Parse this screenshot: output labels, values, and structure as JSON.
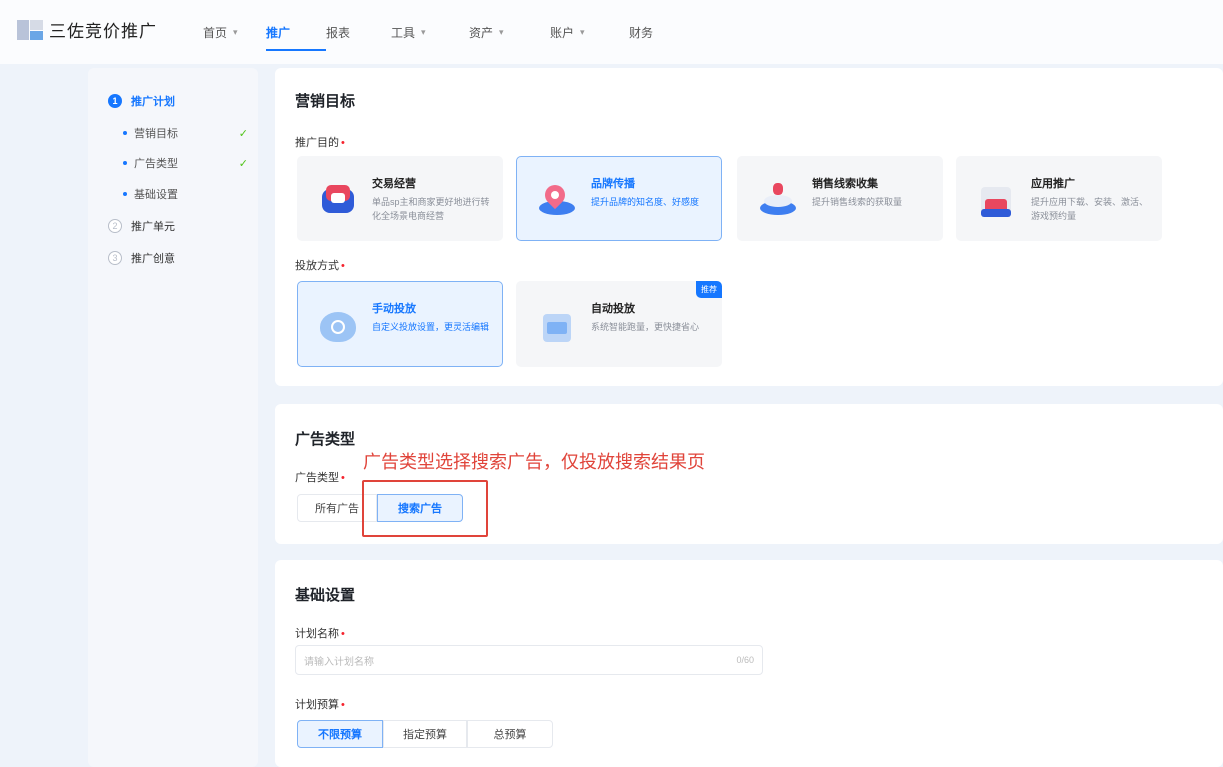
{
  "app": {
    "title": "三佐竞价推广"
  },
  "nav": [
    {
      "label": "首页",
      "chevron": true
    },
    {
      "label": "推广",
      "chevron": false,
      "active": true
    },
    {
      "label": "报表",
      "chevron": false
    },
    {
      "label": "工具",
      "chevron": true
    },
    {
      "label": "资产",
      "chevron": true
    },
    {
      "label": "账户",
      "chevron": true
    },
    {
      "label": "财务",
      "chevron": false
    }
  ],
  "sidebar": {
    "steps": [
      {
        "num": "1",
        "label": "推广计划",
        "active": true
      },
      {
        "num": "2",
        "label": "推广单元",
        "active": false
      },
      {
        "num": "3",
        "label": "推广创意",
        "active": false
      }
    ],
    "sub_items": [
      {
        "label": "营销目标",
        "done": true
      },
      {
        "label": "广告类型",
        "done": true
      },
      {
        "label": "基础设置",
        "done": false
      }
    ],
    "check_glyph": "✓"
  },
  "marketing": {
    "title": "营销目标",
    "purpose_label": "推广目的",
    "purposes": [
      {
        "title": "交易经营",
        "desc": "单品sp主和商家更好地进行转化全场景电商经营",
        "icon": "cube-icon"
      },
      {
        "title": "品牌传播",
        "desc": "提升品牌的知名度、好感度",
        "icon": "brand-icon",
        "selected": true
      },
      {
        "title": "销售线索收集",
        "desc": "提升销售线索的获取量",
        "icon": "leads-icon"
      },
      {
        "title": "应用推广",
        "desc": "提升应用下载、安装、激活、游戏预约量",
        "icon": "app-icon"
      }
    ],
    "method_label": "投放方式",
    "methods": [
      {
        "title": "手动投放",
        "desc": "自定义投放设置，更灵活编辑",
        "icon": "manual-icon",
        "selected": true
      },
      {
        "title": "自动投放",
        "desc": "系统智能跑量，更快捷省心",
        "icon": "auto-icon",
        "badge": "推荐"
      }
    ]
  },
  "ad_type": {
    "title": "广告类型",
    "label": "广告类型",
    "options": [
      "所有广告",
      "搜索广告"
    ],
    "selected": "搜索广告"
  },
  "basic": {
    "title": "基础设置",
    "name_label": "计划名称",
    "name_placeholder": "请输入计划名称",
    "name_count": "0/60",
    "budget_label": "计划预算",
    "budget_options": [
      "不限预算",
      "指定预算",
      "总预算"
    ],
    "budget_selected": "不限预算"
  },
  "annotation": {
    "text": "广告类型选择搜索广告，仅投放搜索结果页",
    "color": "#e0443a"
  },
  "colors": {
    "accent": "#1677ff",
    "required": "#f5222d",
    "success": "#52c41a"
  }
}
